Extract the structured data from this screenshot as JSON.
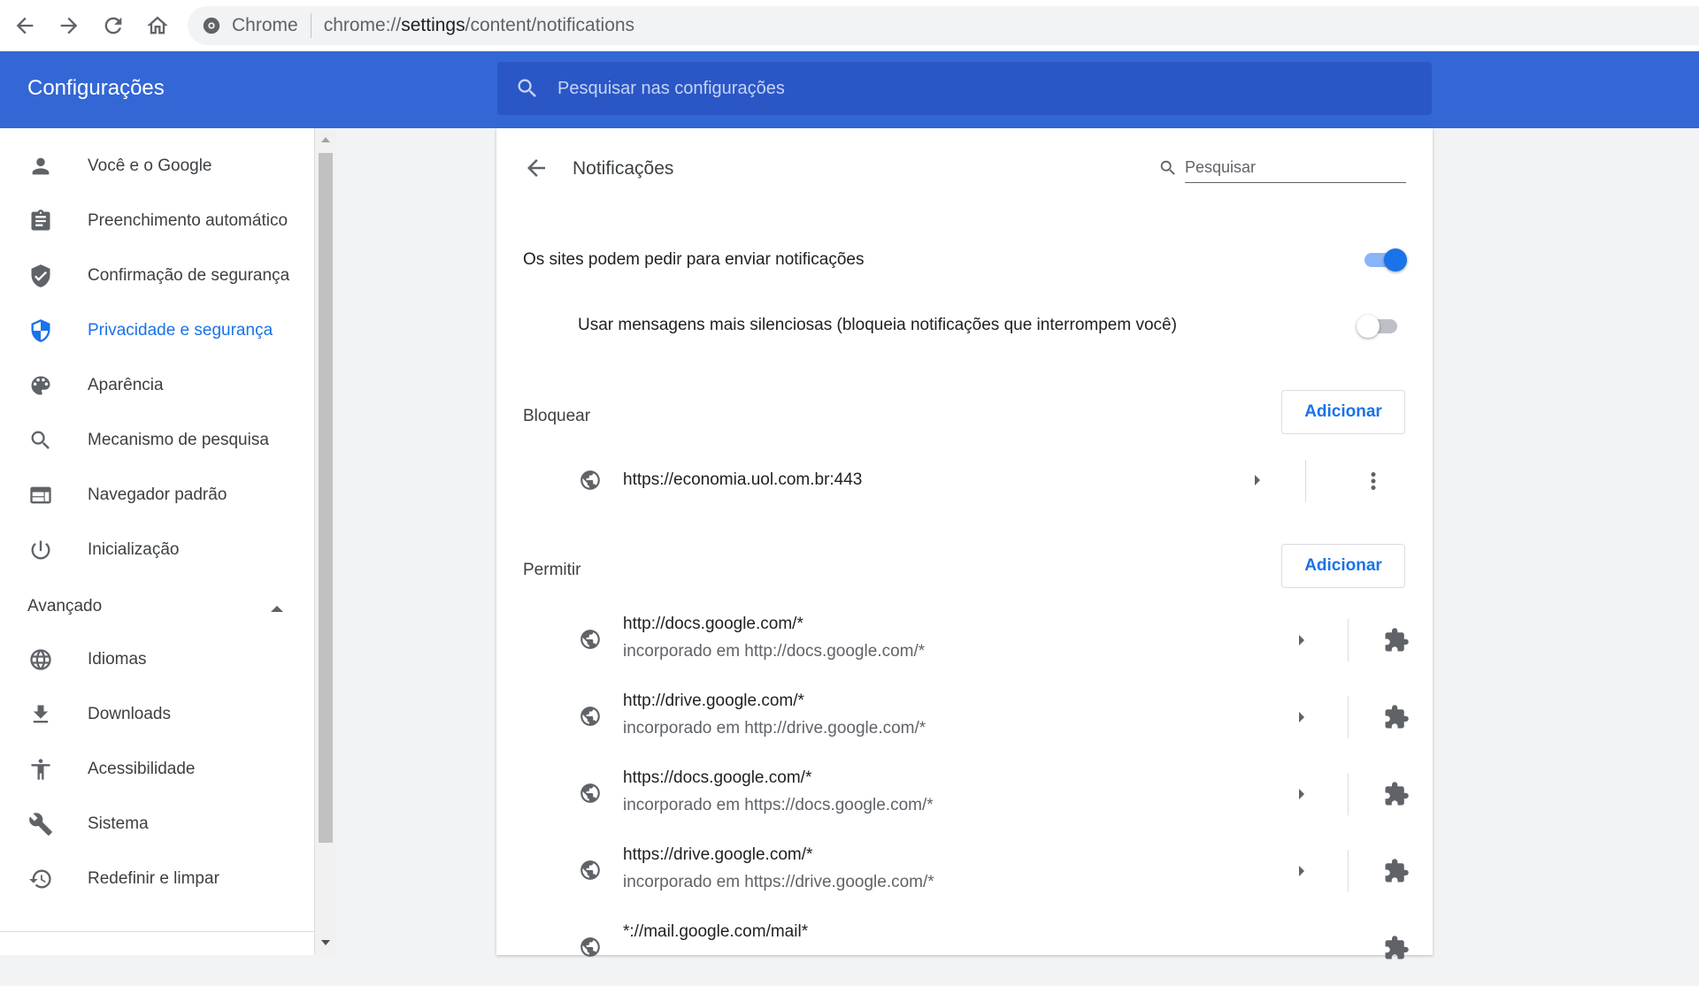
{
  "browser": {
    "chip_label": "Chrome",
    "url_scheme": "chrome://",
    "url_host": "settings",
    "url_path": "/content/notifications"
  },
  "header": {
    "title": "Configurações",
    "search_placeholder": "Pesquisar nas configurações"
  },
  "sidebar": {
    "items": [
      {
        "label": "Você e o Google",
        "icon": "person-icon"
      },
      {
        "label": "Preenchimento automático",
        "icon": "clipboard-icon"
      },
      {
        "label": "Confirmação de segurança",
        "icon": "shield-check-icon"
      },
      {
        "label": "Privacidade e segurança",
        "icon": "shield-icon",
        "active": true
      },
      {
        "label": "Aparência",
        "icon": "palette-icon"
      },
      {
        "label": "Mecanismo de pesquisa",
        "icon": "search-icon"
      },
      {
        "label": "Navegador padrão",
        "icon": "browser-window-icon"
      },
      {
        "label": "Inicialização",
        "icon": "power-icon"
      }
    ],
    "advanced_label": "Avançado",
    "advanced_items": [
      {
        "label": "Idiomas",
        "icon": "globe-icon"
      },
      {
        "label": "Downloads",
        "icon": "download-icon"
      },
      {
        "label": "Acessibilidade",
        "icon": "accessibility-icon"
      },
      {
        "label": "Sistema",
        "icon": "wrench-icon"
      },
      {
        "label": "Redefinir e limpar",
        "icon": "restore-icon"
      }
    ]
  },
  "page": {
    "title": "Notificações",
    "search_placeholder": "Pesquisar",
    "ask_toggle_label": "Os sites podem pedir para enviar notificações",
    "ask_toggle_on": true,
    "quiet_toggle_label": "Usar mensagens mais silenciosas (bloqueia notificações que interrompem você)",
    "quiet_toggle_on": false,
    "block": {
      "title": "Bloquear",
      "add_label": "Adicionar",
      "sites": [
        {
          "url": "https://economia.uol.com.br:443"
        }
      ]
    },
    "allow": {
      "title": "Permitir",
      "add_label": "Adicionar",
      "sites": [
        {
          "url": "http://docs.google.com/*",
          "embedded": "incorporado em http://docs.google.com/*"
        },
        {
          "url": "http://drive.google.com/*",
          "embedded": "incorporado em http://drive.google.com/*"
        },
        {
          "url": "https://docs.google.com/*",
          "embedded": "incorporado em https://docs.google.com/*"
        },
        {
          "url": "https://drive.google.com/*",
          "embedded": "incorporado em https://drive.google.com/*"
        },
        {
          "url": "*://mail.google.com/mail*",
          "embedded": ""
        }
      ]
    }
  },
  "colors": {
    "accent": "#1a73e8",
    "toolbar": "#3367d6",
    "searchbox": "#2a56c6"
  }
}
